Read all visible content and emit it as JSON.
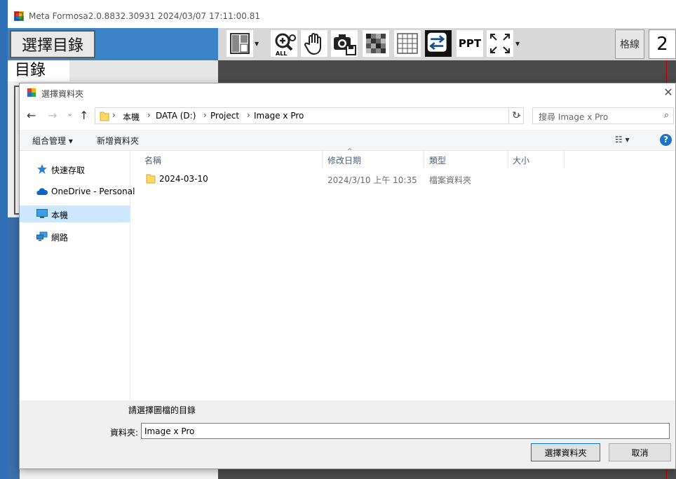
{
  "app": {
    "title": "Meta Formosa2.0.8832.30931 2024/03/07 17:11:00.81",
    "select_dir_label": "選擇目錄",
    "dir_label": "目錄",
    "toolbar": {
      "ppt_label": "PPT",
      "grid_label": "格線",
      "grid_value": "2"
    }
  },
  "dialog": {
    "title": "選擇資料夾",
    "address": {
      "crumbs": [
        "本機",
        "DATA (D:)",
        "Project",
        "Image x Pro"
      ]
    },
    "search_placeholder": "搜尋 Image x Pro",
    "commands": {
      "organize": "組合管理 ▾",
      "new_folder": "新增資料夾"
    },
    "nav_pane": [
      {
        "label": "快速存取",
        "icon": "star-icon"
      },
      {
        "label": "OneDrive - Personal",
        "icon": "cloud-icon"
      },
      {
        "label": "本機",
        "icon": "computer-icon",
        "selected": true
      },
      {
        "label": "網路",
        "icon": "network-icon"
      }
    ],
    "columns": [
      "名稱",
      "修改日期",
      "類型",
      "大小"
    ],
    "rows": [
      {
        "name": "2024-03-10",
        "modified": "2024/3/10 上午 10:35",
        "type": "檔案資料夾",
        "size": ""
      }
    ],
    "prompt": "請選擇圖檔的目錄",
    "folder_label": "資料夾:",
    "folder_value": "Image x Pro",
    "ok_label": "選擇資料夾",
    "cancel_label": "取消"
  }
}
